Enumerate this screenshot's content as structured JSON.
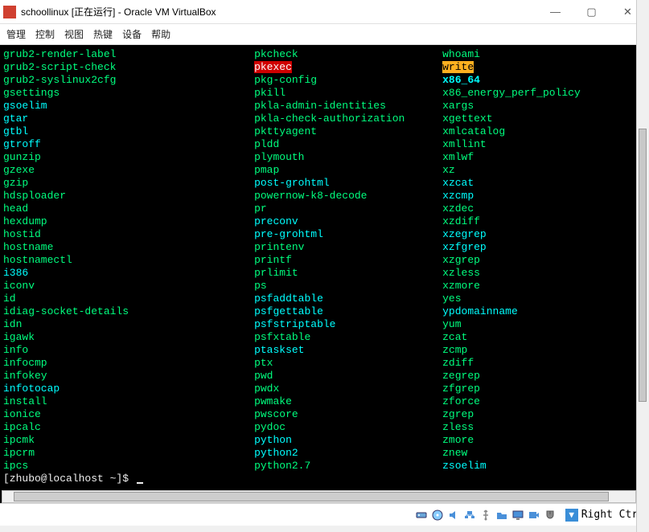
{
  "window": {
    "title": "schoollinux [正在运行] - Oracle VM VirtualBox"
  },
  "menu": [
    "管理",
    "控制",
    "视图",
    "热键",
    "设备",
    "帮助"
  ],
  "terminal": {
    "rows": [
      [
        {
          "t": "grub2-render-label",
          "c": "g"
        },
        {
          "t": "pkcheck",
          "c": "g"
        },
        {
          "t": "whoami",
          "c": "g"
        }
      ],
      [
        {
          "t": "grub2-script-check",
          "c": "g"
        },
        {
          "t": "pkexec",
          "c": "hr"
        },
        {
          "t": "write",
          "c": "hy"
        }
      ],
      [
        {
          "t": "grub2-syslinux2cfg",
          "c": "g"
        },
        {
          "t": "pkg-config",
          "c": "g"
        },
        {
          "t": "x86_64",
          "c": "cb"
        }
      ],
      [
        {
          "t": "gsettings",
          "c": "g"
        },
        {
          "t": "pkill",
          "c": "g"
        },
        {
          "t": "x86_energy_perf_policy",
          "c": "g"
        }
      ],
      [
        {
          "t": "gsoelim",
          "c": "c"
        },
        {
          "t": "pkla-admin-identities",
          "c": "g"
        },
        {
          "t": "xargs",
          "c": "g"
        }
      ],
      [
        {
          "t": "gtar",
          "c": "c"
        },
        {
          "t": "pkla-check-authorization",
          "c": "g"
        },
        {
          "t": "xgettext",
          "c": "g"
        }
      ],
      [
        {
          "t": "gtbl",
          "c": "c"
        },
        {
          "t": "pkttyagent",
          "c": "g"
        },
        {
          "t": "xmlcatalog",
          "c": "g"
        }
      ],
      [
        {
          "t": "gtroff",
          "c": "c"
        },
        {
          "t": "pldd",
          "c": "g"
        },
        {
          "t": "xmllint",
          "c": "g"
        }
      ],
      [
        {
          "t": "gunzip",
          "c": "g"
        },
        {
          "t": "plymouth",
          "c": "g"
        },
        {
          "t": "xmlwf",
          "c": "g"
        }
      ],
      [
        {
          "t": "gzexe",
          "c": "g"
        },
        {
          "t": "pmap",
          "c": "g"
        },
        {
          "t": "xz",
          "c": "g"
        }
      ],
      [
        {
          "t": "gzip",
          "c": "g"
        },
        {
          "t": "post-grohtml",
          "c": "c"
        },
        {
          "t": "xzcat",
          "c": "c"
        }
      ],
      [
        {
          "t": "hdsploader",
          "c": "g"
        },
        {
          "t": "powernow-k8-decode",
          "c": "g"
        },
        {
          "t": "xzcmp",
          "c": "c"
        }
      ],
      [
        {
          "t": "head",
          "c": "g"
        },
        {
          "t": "pr",
          "c": "g"
        },
        {
          "t": "xzdec",
          "c": "g"
        }
      ],
      [
        {
          "t": "hexdump",
          "c": "g"
        },
        {
          "t": "preconv",
          "c": "c"
        },
        {
          "t": "xzdiff",
          "c": "g"
        }
      ],
      [
        {
          "t": "hostid",
          "c": "g"
        },
        {
          "t": "pre-grohtml",
          "c": "c"
        },
        {
          "t": "xzegrep",
          "c": "c"
        }
      ],
      [
        {
          "t": "hostname",
          "c": "g"
        },
        {
          "t": "printenv",
          "c": "g"
        },
        {
          "t": "xzfgrep",
          "c": "c"
        }
      ],
      [
        {
          "t": "hostnamectl",
          "c": "g"
        },
        {
          "t": "printf",
          "c": "g"
        },
        {
          "t": "xzgrep",
          "c": "g"
        }
      ],
      [
        {
          "t": "i386",
          "c": "c"
        },
        {
          "t": "prlimit",
          "c": "g"
        },
        {
          "t": "xzless",
          "c": "g"
        }
      ],
      [
        {
          "t": "iconv",
          "c": "g"
        },
        {
          "t": "ps",
          "c": "g"
        },
        {
          "t": "xzmore",
          "c": "g"
        }
      ],
      [
        {
          "t": "id",
          "c": "g"
        },
        {
          "t": "psfaddtable",
          "c": "c"
        },
        {
          "t": "yes",
          "c": "g"
        }
      ],
      [
        {
          "t": "idiag-socket-details",
          "c": "g"
        },
        {
          "t": "psfgettable",
          "c": "c"
        },
        {
          "t": "ypdomainname",
          "c": "c"
        }
      ],
      [
        {
          "t": "idn",
          "c": "g"
        },
        {
          "t": "psfstriptable",
          "c": "c"
        },
        {
          "t": "yum",
          "c": "g"
        }
      ],
      [
        {
          "t": "igawk",
          "c": "g"
        },
        {
          "t": "psfxtable",
          "c": "g"
        },
        {
          "t": "zcat",
          "c": "g"
        }
      ],
      [
        {
          "t": "info",
          "c": "g"
        },
        {
          "t": "ptaskset",
          "c": "c"
        },
        {
          "t": "zcmp",
          "c": "g"
        }
      ],
      [
        {
          "t": "infocmp",
          "c": "g"
        },
        {
          "t": "ptx",
          "c": "g"
        },
        {
          "t": "zdiff",
          "c": "g"
        }
      ],
      [
        {
          "t": "infokey",
          "c": "g"
        },
        {
          "t": "pwd",
          "c": "g"
        },
        {
          "t": "zegrep",
          "c": "g"
        }
      ],
      [
        {
          "t": "infotocap",
          "c": "c"
        },
        {
          "t": "pwdx",
          "c": "g"
        },
        {
          "t": "zfgrep",
          "c": "g"
        }
      ],
      [
        {
          "t": "install",
          "c": "g"
        },
        {
          "t": "pwmake",
          "c": "g"
        },
        {
          "t": "zforce",
          "c": "g"
        }
      ],
      [
        {
          "t": "ionice",
          "c": "g"
        },
        {
          "t": "pwscore",
          "c": "g"
        },
        {
          "t": "zgrep",
          "c": "g"
        }
      ],
      [
        {
          "t": "ipcalc",
          "c": "g"
        },
        {
          "t": "pydoc",
          "c": "g"
        },
        {
          "t": "zless",
          "c": "g"
        }
      ],
      [
        {
          "t": "ipcmk",
          "c": "g"
        },
        {
          "t": "python",
          "c": "c"
        },
        {
          "t": "zmore",
          "c": "g"
        }
      ],
      [
        {
          "t": "ipcrm",
          "c": "g"
        },
        {
          "t": "python2",
          "c": "c"
        },
        {
          "t": "znew",
          "c": "g"
        }
      ],
      [
        {
          "t": "ipcs",
          "c": "g"
        },
        {
          "t": "python2.7",
          "c": "g"
        },
        {
          "t": "zsoelim",
          "c": "c"
        }
      ]
    ],
    "prompt": "[zhubo@localhost ~]$ "
  },
  "statusbar": {
    "host_key": "Right Ctrl"
  }
}
